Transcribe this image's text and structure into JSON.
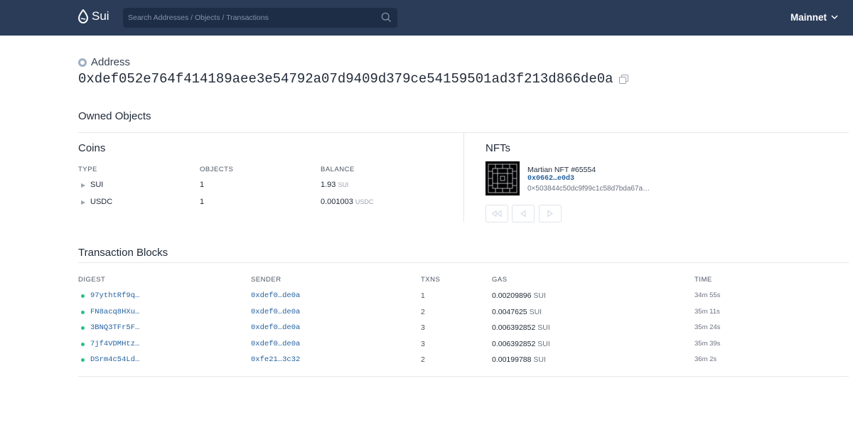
{
  "header": {
    "brand": "Sui",
    "search_placeholder": "Search Addresses / Objects / Transactions",
    "network": "Mainnet",
    "colors": {
      "bar": "#2b3c58",
      "search_bg": "#1e2d46"
    }
  },
  "address": {
    "label": "Address",
    "value": "0xdef052e764f414189aee3e54792a07d9409d379ce54159501ad3f213d866de0a"
  },
  "owned_objects": {
    "title": "Owned Objects",
    "coins": {
      "title": "Coins",
      "columns": [
        "TYPE",
        "OBJECTS",
        "BALANCE"
      ],
      "rows": [
        {
          "symbol": "SUI",
          "objects": "1",
          "balance": "1.93",
          "unit": "SUI"
        },
        {
          "symbol": "USDC",
          "objects": "1",
          "balance": "0.001003",
          "unit": "USDC"
        }
      ]
    },
    "nfts": {
      "title": "NFTs",
      "items": [
        {
          "name": "Martian NFT #65554",
          "id": "0x0662…e0d3",
          "type": "0×503844c50dc9f99c1c58d7bda67a…"
        }
      ]
    }
  },
  "transactions": {
    "title": "Transaction Blocks",
    "columns": [
      "DIGEST",
      "SENDER",
      "TXNS",
      "GAS",
      "TIME"
    ],
    "rows": [
      {
        "digest": "97ythtRf9q…",
        "sender": "0xdef0…de0a",
        "txns": "1",
        "gas": "0.00209896",
        "unit": "SUI",
        "time": "34m 55s"
      },
      {
        "digest": "FN8acq8HXu…",
        "sender": "0xdef0…de0a",
        "txns": "2",
        "gas": "0.0047625",
        "unit": "SUI",
        "time": "35m 11s"
      },
      {
        "digest": "3BNQ3TFr5F…",
        "sender": "0xdef0…de0a",
        "txns": "3",
        "gas": "0.006392852",
        "unit": "SUI",
        "time": "35m 24s"
      },
      {
        "digest": "7jf4VDMHtz…",
        "sender": "0xdef0…de0a",
        "txns": "3",
        "gas": "0.006392852",
        "unit": "SUI",
        "time": "35m 39s"
      },
      {
        "digest": "DSrm4c54Ld…",
        "sender": "0xfe21…3c32",
        "txns": "2",
        "gas": "0.00199788",
        "unit": "SUI",
        "time": "36m 2s"
      }
    ],
    "status_color": "#2bbf8a"
  }
}
